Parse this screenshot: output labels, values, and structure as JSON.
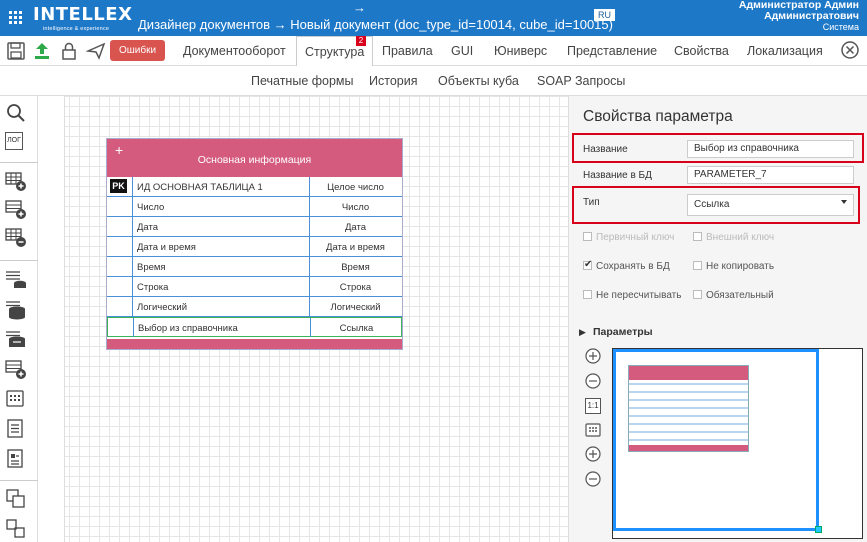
{
  "header": {
    "app_name": "INTELLEX",
    "app_tagline": "intelligence & experience",
    "arrow_top": "→",
    "breadcrumb": "Дизайнер документов  →  Новый документ (doc_type_id=10014, cube_id=10015)",
    "lang": "RU",
    "user_line1": "Администратор Админ",
    "user_line2": "Администратович",
    "user_line3": "Система"
  },
  "toolbar": {
    "errors_label": "Ошибки",
    "tabs": [
      {
        "label": "Документооборот"
      },
      {
        "label": "Структура"
      },
      {
        "label": "Правила"
      },
      {
        "label": "GUI"
      },
      {
        "label": "Юниверс"
      },
      {
        "label": "Представление"
      },
      {
        "label": "Свойства"
      },
      {
        "label": "Локализация"
      }
    ],
    "active_tab": "Структура",
    "structure_badge": "2"
  },
  "subtabs": [
    {
      "label": "Печатные формы"
    },
    {
      "label": "История"
    },
    {
      "label": "Объекты куба"
    },
    {
      "label": "SOAP Запросы"
    }
  ],
  "leftrail": {
    "log_label": "ЛОГ"
  },
  "table": {
    "plus": "+",
    "title": "Основная информация",
    "pk_label": "PK",
    "rows": [
      {
        "name": "ИД ОСНОВНАЯ ТАБЛИЦА 1",
        "type": "Целое число"
      },
      {
        "name": "Число",
        "type": "Число"
      },
      {
        "name": "Дата",
        "type": "Дата"
      },
      {
        "name": "Дата и время",
        "type": "Дата и время"
      },
      {
        "name": "Время",
        "type": "Время"
      },
      {
        "name": "Строка",
        "type": "Строка"
      },
      {
        "name": "Логический",
        "type": "Логический"
      },
      {
        "name": "Выбор из справочника",
        "type": "Ссылка"
      }
    ]
  },
  "properties": {
    "title": "Свойства параметра",
    "name_label": "Название",
    "name_value": "Выбор из справочника",
    "dbname_label": "Название в БД",
    "dbname_value": "PARAMETER_7",
    "type_label": "Тип",
    "type_value": "Ссылка",
    "checkboxes": {
      "primary_key": "Первичный ключ",
      "foreign_key": "Внешний ключ",
      "save_in_db": "Сохранять в БД",
      "no_copy": "Не копировать",
      "no_recalc": "Не пересчитывать",
      "required": "Обязательный"
    },
    "params_label": "Параметры"
  },
  "minimap": {
    "reset_zoom": "1:1"
  },
  "colors": {
    "topbar": "#1e78c8",
    "table_header": "#d45b7e",
    "row_border": "#4a90d9",
    "highlight": "#d9001b",
    "error_button": "#d9534f"
  }
}
